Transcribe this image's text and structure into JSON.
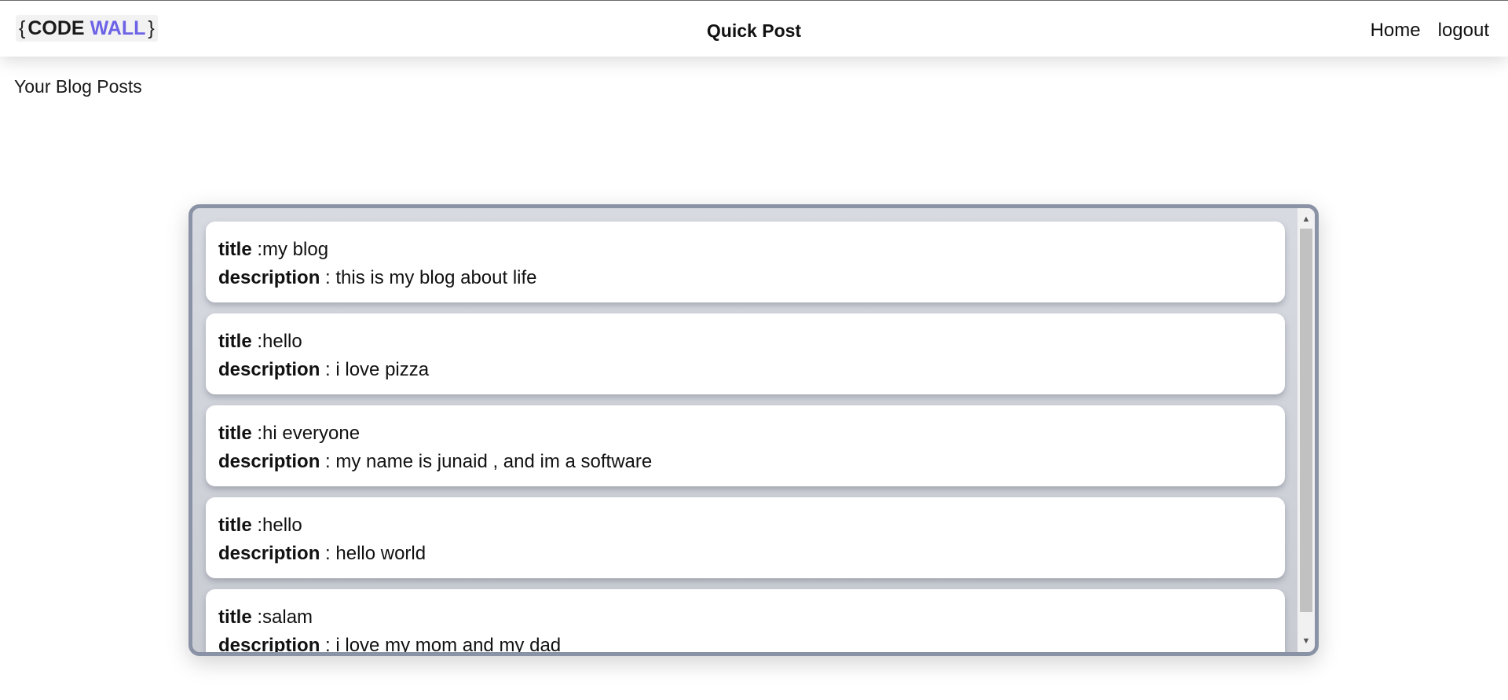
{
  "logo": {
    "brace_open": "{",
    "code": "CODE",
    "wall": "WALL",
    "brace_close": "}"
  },
  "header": {
    "title": "Quick Post",
    "nav": [
      "Home",
      "logout"
    ]
  },
  "page": {
    "heading": "Your Blog Posts"
  },
  "post_labels": {
    "title": "title",
    "title_sep": " :",
    "description": "description",
    "description_sep": " : "
  },
  "posts": [
    {
      "title": "my blog",
      "description": "this is my blog about life"
    },
    {
      "title": "hello",
      "description": "i love pizza"
    },
    {
      "title": "hi everyone",
      "description": "my name is junaid , and im a software"
    },
    {
      "title": "hello",
      "description": "hello world"
    },
    {
      "title": "salam",
      "description": "i love my mom and my dad"
    }
  ],
  "scrollbar": {
    "up_icon": "▲",
    "down_icon": "▼"
  },
  "colors": {
    "brand_accent": "#6c63e6",
    "feed_border": "#8a93a6"
  }
}
